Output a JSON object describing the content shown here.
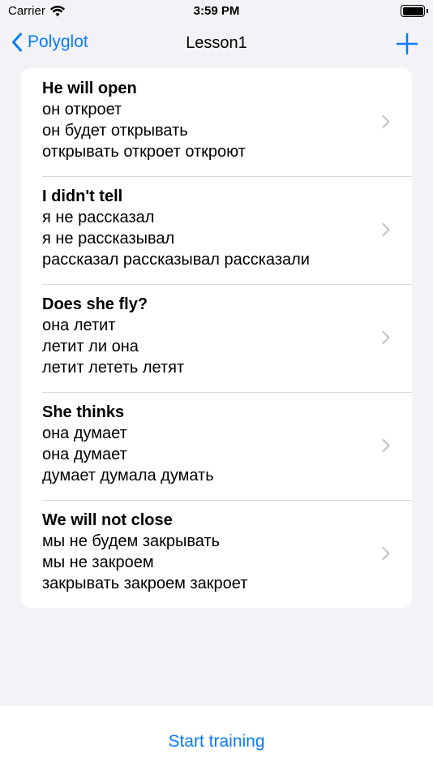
{
  "status_bar": {
    "carrier": "Carrier",
    "time": "3:59 PM"
  },
  "nav": {
    "back_label": "Polyglot",
    "title": "Lesson1"
  },
  "items": [
    {
      "title": "He will open",
      "lines": [
        "он откроет",
        "он будет открывать",
        "открывать откроет откроют"
      ]
    },
    {
      "title": "I didn't tell",
      "lines": [
        "я не рассказал",
        "я не рассказывал",
        "рассказал рассказывал рассказали"
      ]
    },
    {
      "title": "Does she fly?",
      "lines": [
        "она летит",
        "летит ли она",
        "летит лететь летят"
      ]
    },
    {
      "title": "She thinks",
      "lines": [
        "она думает",
        "она думает",
        "думает думала думать"
      ]
    },
    {
      "title": "We will not close",
      "lines": [
        "мы не будем закрывать",
        "мы не закроем",
        "закрывать закроем закроет"
      ]
    }
  ],
  "footer": {
    "start_label": "Start training"
  },
  "colors": {
    "accent": "#0a7aff",
    "background": "#f2f2f7",
    "card": "#ffffff",
    "chevron": "#c4c4c7"
  }
}
